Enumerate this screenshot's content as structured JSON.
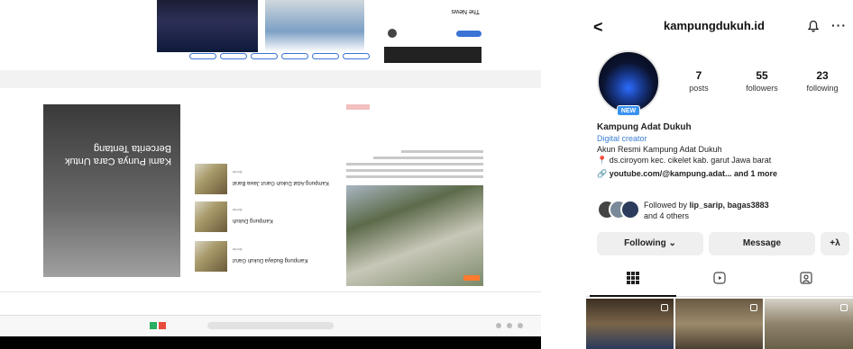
{
  "instagram": {
    "username": "kampungdukuh.id",
    "back_icon": "chevron-left-icon",
    "bell_icon": "bell-icon",
    "more_icon": "more-horizontal-icon",
    "more_label": "···",
    "new_badge": "NEW",
    "stats": [
      {
        "value": "7",
        "label": "posts"
      },
      {
        "value": "55",
        "label": "followers"
      },
      {
        "value": "23",
        "label": "following"
      }
    ],
    "profile": {
      "name": "Kampung Adat Dukuh",
      "category": "Digital creator",
      "bio_line1": "Akun Resmi Kampung Adat Dukuh",
      "bio_line2": "ds.ciroyom kec. cikelet kab. garut Jawa barat",
      "link_text": "youtube.com/@kampung.adat...",
      "link_more": "and 1 more"
    },
    "followed_by": {
      "prefix": "Followed by",
      "names": "lip_sarip, bagas3883",
      "suffix": "and 4 others"
    },
    "buttons": {
      "following": "Following ⌄",
      "message": "Message",
      "add_person": "+λ"
    },
    "tabs": [
      "grid-icon",
      "reels-icon",
      "tagged-icon"
    ],
    "colors": {
      "category_blue": "#3a7fd3",
      "new_badge_blue": "#3a92f0",
      "button_gray": "#efefef"
    }
  },
  "webpage": {
    "card_title": "Kami Punya Cara Untuk Bercerita Tentang",
    "newsletter_label": "The News",
    "list_items": [
      {
        "title": "Kampung Adat Dukuh Garut Jawa Barat",
        "date": "Berita"
      },
      {
        "title": "Kampung Dukuh",
        "date": "Berita"
      },
      {
        "title": "Kampung Budaya Dukuh Garut",
        "date": "Berita"
      }
    ]
  }
}
